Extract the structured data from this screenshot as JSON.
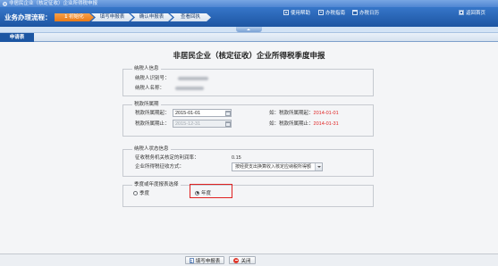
{
  "window": {
    "title": "非居民企业（核定征收）企业所得税申报",
    "icon": "app-icon"
  },
  "header": {
    "flow_label": "业务办理流程：",
    "steps": [
      {
        "number": "1",
        "label": "初始化",
        "active": true
      },
      {
        "label": "填写申报表",
        "active": false
      },
      {
        "label": "确认申报表",
        "active": false
      },
      {
        "label": "查看回执",
        "active": false
      }
    ],
    "links": [
      {
        "label": "使用帮助",
        "icon": "help-icon"
      },
      {
        "label": "办税指南",
        "icon": "guide-icon"
      },
      {
        "label": "办税日历",
        "icon": "calendar-icon"
      }
    ],
    "home": {
      "label": "返回首页",
      "icon": "home-icon"
    }
  },
  "tabs": [
    {
      "label": "申请表",
      "active": true
    }
  ],
  "form": {
    "title": "非居民企业（核定征收）企业所得税季度申报",
    "taxpayer_info": {
      "legend": "纳税人信息",
      "id_label": "纳税人识别号：",
      "name_label": "纳税人名称："
    },
    "tax_period": {
      "legend": "税款所属期",
      "start_label": "税款所属期起：",
      "start_value": "2015-01-01",
      "start_hint_prefix": "如：税款所属期起：",
      "start_hint_example": "2014-01-01",
      "end_label": "税款所属期止：",
      "end_value": "2015-12-31",
      "end_disabled": true,
      "end_hint_prefix": "如：税款所属期止：",
      "end_hint_example": "2014-01-31"
    },
    "status_info": {
      "legend": "纳税人状态信息",
      "profit_rate_label": "征收税务机关核定的利润率：",
      "profit_rate_value": "0.15",
      "levy_method_label": "企业所得税征收方式：",
      "levy_method_selected": "按经费支出换算收入核定应纳税所得额"
    },
    "report_type": {
      "legend": "季度或年度报表选择",
      "options": [
        {
          "label": "季度",
          "checked": false
        },
        {
          "label": "年度",
          "checked": true
        }
      ]
    }
  },
  "footer": {
    "fill_button": {
      "label": "填写申报表",
      "icon": "edit-icon"
    },
    "close_button": {
      "label": "关闭",
      "icon": "close-icon"
    }
  },
  "colors": {
    "header_blue": "#1d55a2",
    "step_active": "#f08a24",
    "hint_red": "#e02424",
    "highlight_red": "#e02020"
  }
}
